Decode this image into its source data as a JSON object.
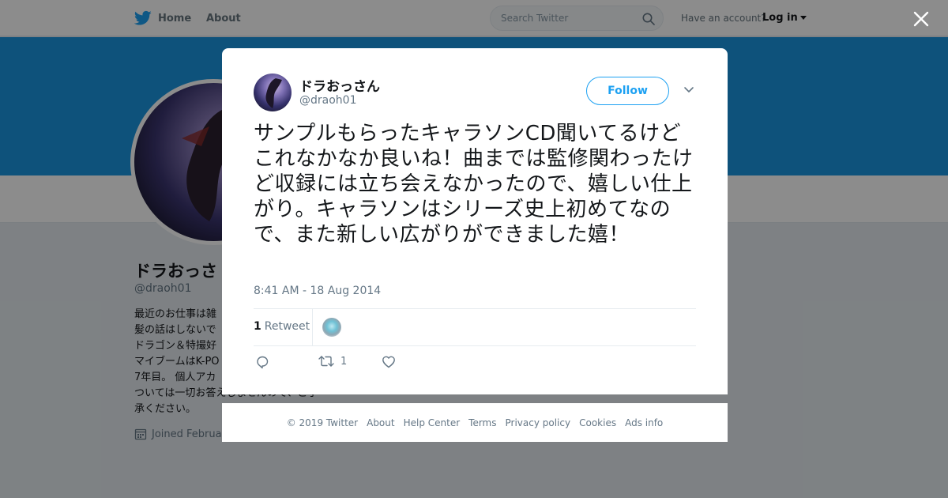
{
  "nav": {
    "home": "Home",
    "about": "About",
    "search_placeholder": "Search Twitter",
    "account_prompt": "Have an account?",
    "login": "Log in"
  },
  "profile": {
    "name": "ドラおっさ",
    "handle": "@draoh01",
    "bio_lines": [
      "最近のお仕事は雑",
      "髪の話はしないで",
      "ドラゴン＆特撮好",
      "マイブームはK-PO",
      "7年目。 個人アカ",
      "ついては一切お答えしませんので、ご了",
      "承ください。"
    ],
    "joined": "Joined Februa"
  },
  "tweet": {
    "author_name": "ドラおっさん",
    "author_handle": "@draoh01",
    "follow_label": "Follow",
    "text": "サンプルもらったキャラソンCD聞いてるけどこれなかなか良いね！曲までは監修関わったけど収録には立ち会えなかったので、嬉しい仕上がり。キャラソンはシリーズ史上初めてなので、また新しい広がりができました嬉！",
    "timestamp": "8:41 AM - 18 Aug 2014",
    "retweet_count": "1",
    "retweet_label": "Retweet",
    "action_retweet_count": "1"
  },
  "footer": {
    "links": [
      "© 2019 Twitter",
      "About",
      "Help Center",
      "Terms",
      "Privacy policy",
      "Cookies",
      "Ads info"
    ]
  },
  "colors": {
    "brand": "#1da1f2",
    "banner": "#1b95e0",
    "text": "#14171a",
    "muted": "#657786"
  },
  "icons": {
    "logo": "twitter-bird-icon",
    "search": "search-icon",
    "close": "close-icon",
    "caret": "chevron-down-icon",
    "reply": "reply-icon",
    "retweet": "retweet-icon",
    "like": "heart-icon",
    "calendar": "calendar-icon"
  }
}
